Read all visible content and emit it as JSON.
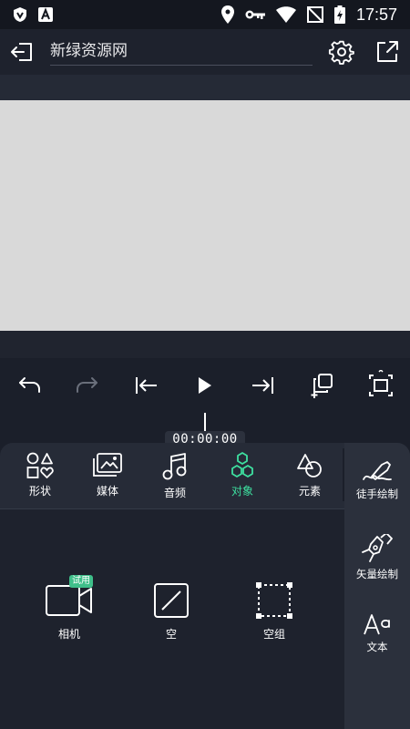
{
  "status_bar": {
    "time": "17:57",
    "icons": [
      "shield-app-icon",
      "a-app-icon",
      "location-icon",
      "key-icon",
      "wifi-icon",
      "no-sim-icon",
      "battery-icon"
    ]
  },
  "header": {
    "project_title": "新绿资源网",
    "icons": [
      "back-icon",
      "gear-icon",
      "export-icon"
    ]
  },
  "transport": {
    "icons": [
      "undo-icon",
      "redo-icon",
      "skip-start-icon",
      "play-icon",
      "skip-end-icon",
      "duplicate-icon",
      "fullscreen-icon"
    ]
  },
  "timeline": {
    "timecode": "00:00:00"
  },
  "tabs": [
    {
      "label": "形状",
      "icon": "shapes-icon",
      "active": false
    },
    {
      "label": "媒体",
      "icon": "media-icon",
      "active": false
    },
    {
      "label": "音频",
      "icon": "music-note-icon",
      "active": false
    },
    {
      "label": "对象",
      "icon": "hexagons-icon",
      "active": true
    },
    {
      "label": "元素",
      "icon": "elements-icon",
      "active": false
    }
  ],
  "side_tools": [
    {
      "label": "徒手绘制",
      "icon": "freehand-draw-icon"
    },
    {
      "label": "矢量绘制",
      "icon": "vector-pen-icon"
    },
    {
      "label": "文本",
      "icon": "text-icon"
    }
  ],
  "objects": [
    {
      "label": "相机",
      "icon": "camera-icon",
      "badge": "试用"
    },
    {
      "label": "空",
      "icon": "null-object-icon"
    },
    {
      "label": "空组",
      "icon": "null-group-icon"
    }
  ],
  "colors": {
    "accent": "#3ee0a0",
    "badge": "#3fbf8a",
    "canvas": "#d9d9d9",
    "background": "#1b1f2a"
  }
}
